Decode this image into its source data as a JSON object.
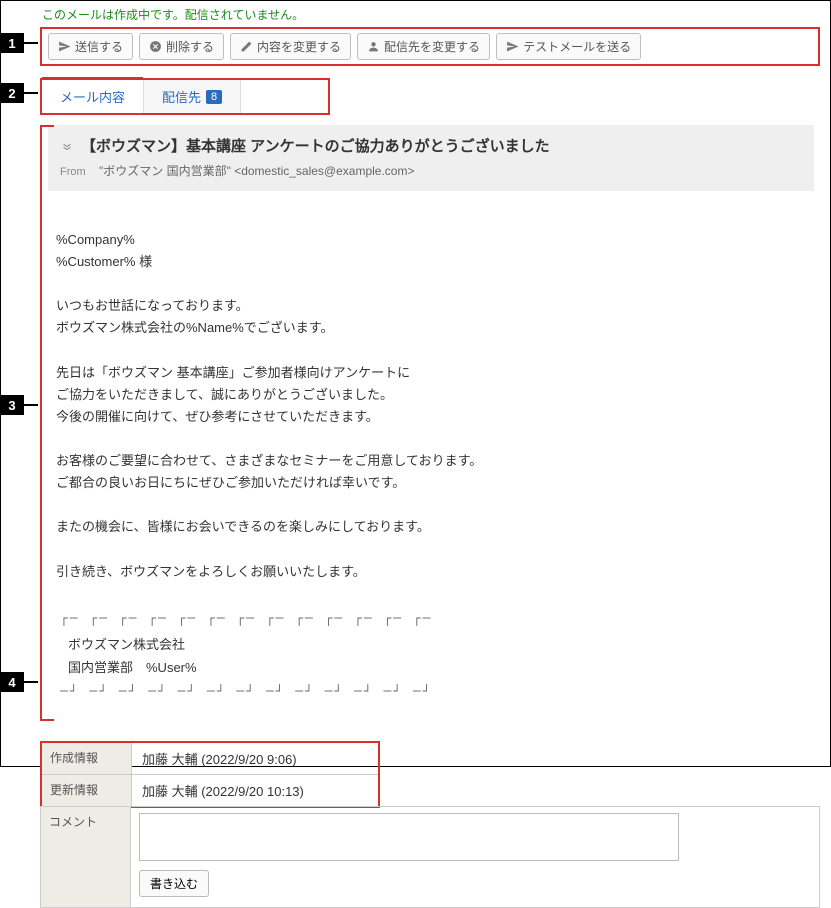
{
  "status_message": "このメールは作成中です。配信されていません。",
  "toolbar": {
    "send": "送信する",
    "delete": "削除する",
    "edit_content": "内容を変更する",
    "edit_recipients": "配信先を変更する",
    "send_test": "テストメールを送る"
  },
  "tabs": {
    "content": "メール内容",
    "recipients": "配信先",
    "recipients_count": "8"
  },
  "mail": {
    "subject": "【ボウズマン】基本講座 アンケートのご協力ありがとうございました",
    "from_label": "From",
    "from": "\"ボウズマン 国内営業部\" <domestic_sales@example.com>",
    "body_1": "%Company%\n%Customer% 様",
    "body_2": "いつもお世話になっております。\nボウズマン株式会社の%Name%でございます。",
    "body_3": "先日は「ボウズマン 基本講座」ご参加者様向けアンケートに\nご協力をいただきまして、誠にありがとうございました。\n今後の開催に向けて、ぜひ参考にさせていただきます。",
    "body_4": "お客様のご要望に合わせて、さまざまなセミナーをご用意しております。\nご都合の良いお日にちにぜひご参加いただければ幸いです。",
    "body_5": "またの機会に、皆様にお会いできるのを楽しみにしております。",
    "body_6": "引き続き、ボウズマンをよろしくお願いいたします。",
    "divider_top": "┌─ ┌─ ┌─ ┌─ ┌─ ┌─ ┌─ ┌─ ┌─ ┌─ ┌─ ┌─ ┌─",
    "sig_1": "ボウズマン株式会社",
    "sig_2": "国内営業部　%User%",
    "divider_bottom": "─┘ ─┘ ─┘ ─┘ ─┘ ─┘ ─┘ ─┘ ─┘ ─┘ ─┘ ─┘ ─┘"
  },
  "meta": {
    "created_label": "作成情報",
    "created_value": "加藤 大輔 (2022/9/20 9:06)",
    "updated_label": "更新情報",
    "updated_value": "加藤 大輔 (2022/9/20 10:13)"
  },
  "comment": {
    "label": "コメント",
    "placeholder": "",
    "write_button": "書き込む"
  },
  "callouts": {
    "1": "1",
    "2": "2",
    "3": "3",
    "4": "4"
  }
}
